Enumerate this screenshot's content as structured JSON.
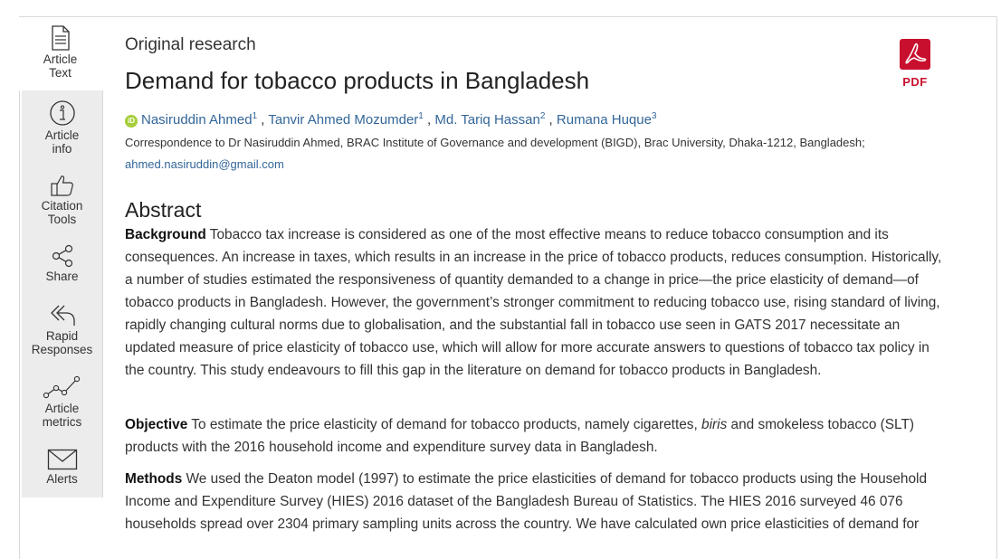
{
  "sidebar": {
    "items": [
      {
        "label_1": "Article",
        "label_2": "Text",
        "icon": "document-icon",
        "active": true
      },
      {
        "label_1": "Article",
        "label_2": "info",
        "icon": "info-icon"
      },
      {
        "label_1": "Citation",
        "label_2": "Tools",
        "icon": "thumbs-up-icon"
      },
      {
        "label_1": "Share",
        "label_2": "",
        "icon": "share-icon"
      },
      {
        "label_1": "Rapid",
        "label_2": "Responses",
        "icon": "reply-icon"
      },
      {
        "label_1": "Article",
        "label_2": "metrics",
        "icon": "line-chart-icon"
      },
      {
        "label_1": "Alerts",
        "label_2": "",
        "icon": "envelope-icon"
      }
    ]
  },
  "article": {
    "type": "Original research",
    "title": "Demand for tobacco products in Bangladesh",
    "pdf_label": "PDF",
    "authors": [
      {
        "name": "Nasiruddin Ahmed",
        "sup": "1"
      },
      {
        "name": "Tanvir Ahmed Mozumder",
        "sup": "1"
      },
      {
        "name": "Md. Tariq Hassan",
        "sup": "2"
      },
      {
        "name": "Rumana Huque",
        "sup": "3"
      }
    ],
    "orcid_label": "iD",
    "correspondence": "Correspondence to Dr Nasiruddin Ahmed, BRAC Institute of Governance and development (BIGD), Brac University, Dhaka-1212, Bangladesh;",
    "email": "ahmed.nasiruddin@gmail.com"
  },
  "abstract": {
    "heading": "Abstract",
    "background_label": "Background",
    "background_text": "Tobacco tax increase is considered as one of the most effective means to reduce tobacco consumption and its consequences. An increase in taxes, which results in an increase in the price of tobacco products, reduces consumption. Historically, a number of studies estimated the responsiveness of quantity demanded to a change in price—the price elasticity of demand—of tobacco products in Bangladesh. However, the government’s stronger commitment to reducing tobacco use, rising standard of living, rapidly changing cultural norms due to globalisation, and the substantial fall in tobacco use seen in GATS 2017 necessitate an updated measure of price elasticity of tobacco use, which will allow for more accurate answers to questions of tobacco tax policy in the country. This study endeavours to fill this gap in the literature on demand for tobacco products in Bangladesh.",
    "objective_label": "Objective",
    "objective_text_1": "To estimate the price elasticity of demand for tobacco products, namely cigarettes,",
    "objective_italic": "biris",
    "objective_text_2": "and smokeless tobacco (SLT) products with the 2016 household income and expenditure survey data in Bangladesh.",
    "methods_label": "Methods",
    "methods_text": "We used the Deaton model (1997) to estimate the price elasticities of demand for tobacco products using the Household Income and Expenditure Survey (HIES) 2016 dataset of the Bangladesh Bureau of Statistics. The HIES 2016 surveyed 46 076 households spread over 2304 primary sampling units across the country. We have calculated own price elasticities of demand for"
  },
  "colors": {
    "link": "#336699",
    "pdf_red": "#c8102e",
    "orcid_green": "#a6ce39",
    "rail_bg": "#ececec"
  }
}
